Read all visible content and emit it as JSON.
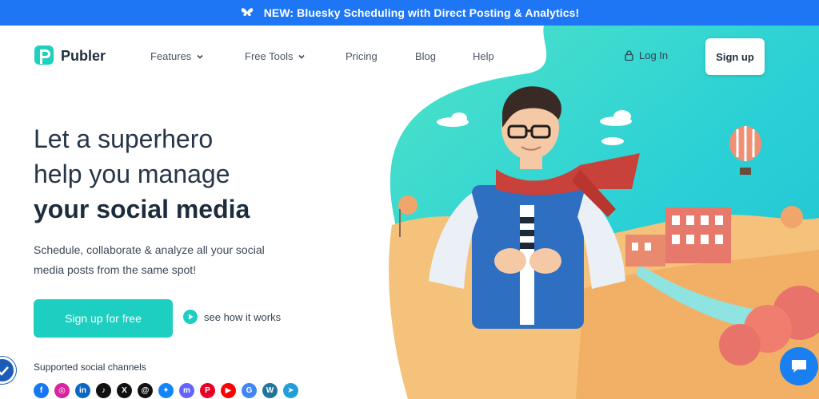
{
  "colors": {
    "banner": "#1e76f5",
    "accent": "#1ccfc0",
    "text": "#28374a",
    "chat": "#1a7ff0"
  },
  "banner": {
    "icon": "butterfly-icon",
    "text": "NEW: Bluesky Scheduling with Direct Posting & Analytics!"
  },
  "header": {
    "brand": "Publer",
    "nav": [
      {
        "label": "Features",
        "has_dropdown": true
      },
      {
        "label": "Free Tools",
        "has_dropdown": true
      },
      {
        "label": "Pricing",
        "has_dropdown": false
      },
      {
        "label": "Blog",
        "has_dropdown": false
      },
      {
        "label": "Help",
        "has_dropdown": false
      }
    ],
    "login_label": "Log In",
    "login_icon": "lock-icon",
    "signup_label": "Sign up"
  },
  "hero": {
    "line1": "Let a superhero",
    "line2": "help you manage",
    "line3": "your social media",
    "subtitle": "Schedule, collaborate & analyze all your social media posts from the same spot!",
    "cta_label": "Sign up for free",
    "howto_label": "see how it works"
  },
  "channels": {
    "label": "Supported social channels",
    "items": [
      {
        "name": "facebook-icon",
        "glyph": "f",
        "color": "#1877f2"
      },
      {
        "name": "instagram-icon",
        "glyph": "◎",
        "color": "#d6249f"
      },
      {
        "name": "linkedin-icon",
        "glyph": "in",
        "color": "#0a66c2"
      },
      {
        "name": "tiktok-icon",
        "glyph": "♪",
        "color": "#111111"
      },
      {
        "name": "x-icon",
        "glyph": "X",
        "color": "#111111"
      },
      {
        "name": "threads-icon",
        "glyph": "@",
        "color": "#111111"
      },
      {
        "name": "bluesky-icon",
        "glyph": "✦",
        "color": "#1185fe"
      },
      {
        "name": "mastodon-icon",
        "glyph": "m",
        "color": "#6364ff"
      },
      {
        "name": "pinterest-icon",
        "glyph": "P",
        "color": "#e60023"
      },
      {
        "name": "youtube-icon",
        "glyph": "▶",
        "color": "#ff0000"
      },
      {
        "name": "google-business-icon",
        "glyph": "G",
        "color": "#4285f4"
      },
      {
        "name": "wordpress-icon",
        "glyph": "W",
        "color": "#21759b"
      },
      {
        "name": "telegram-icon",
        "glyph": "➤",
        "color": "#229ed9"
      }
    ]
  },
  "widgets": {
    "chat_icon": "chat-bubble-icon",
    "badge_icon": "verified-check-icon"
  }
}
